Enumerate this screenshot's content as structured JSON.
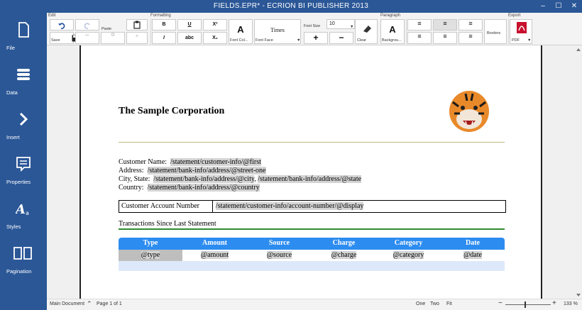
{
  "window": {
    "title": "FIELDS.EPR* - ECRION BI PUBLISHER 2013",
    "minimize": "–",
    "maximize": "☐",
    "close": "✕"
  },
  "nav": [
    {
      "label": "File",
      "icon": "file-icon"
    },
    {
      "label": "Data",
      "icon": "data-icon"
    },
    {
      "label": "Insert",
      "icon": "insert-icon"
    },
    {
      "label": "Properties",
      "icon": "properties-icon"
    },
    {
      "label": "Styles",
      "icon": "styles-icon"
    },
    {
      "label": "Pagination",
      "icon": "pagination-icon"
    }
  ],
  "ribbon": {
    "groups": {
      "edit": "Edit",
      "formatting": "Formatting",
      "paragraph": "Paragraph",
      "export": "Export"
    },
    "save": "Save",
    "paste": "Paste",
    "bold": "B",
    "italic": "I",
    "underline": "U",
    "strike": "abc",
    "superscript": "X²",
    "subscript": "X₂",
    "font_color": "Font Col...",
    "font_color_glyph": "A",
    "font_face": "Font Face",
    "font_face_value": "Times",
    "font_size_label": "Font Size",
    "font_size_value": "10",
    "increase": "+",
    "decrease": "−",
    "clear": "Clear",
    "background": "Backgrou...",
    "background_glyph": "A",
    "borders": "Borders",
    "export_pdf": "PDF"
  },
  "document": {
    "company": "The Sample Corporation",
    "customer": {
      "name_label": "Customer Name:",
      "name_field": "/statement/customer-info/@first",
      "address_label": "Address:",
      "address_field": "/statement/bank-info/address/@street-one",
      "city_label": "City, State:",
      "city_field": "/statement/bank-info/address/@city",
      "state_field": "/statement/bank-info/address/@state",
      "country_label": "Country:",
      "country_field": "/statement/bank-info/address/@country"
    },
    "account_label": "Customer Account Number",
    "account_field": "/statement/customer-info/account-number/@display",
    "transactions_title": "Transactions Since Last Statement",
    "table": {
      "headers": [
        "Type",
        "Amount",
        "Source",
        "Charge",
        "Category",
        "Date"
      ],
      "row": [
        "@type",
        "@amount",
        "@source",
        "@charge",
        "@category",
        "@date"
      ]
    }
  },
  "status": {
    "main_doc": "Main Document",
    "page": "Page 1 of 1",
    "one": "One",
    "two": "Two",
    "fit": "Fit",
    "zoom": "133 %",
    "zoom_fraction": 0.42
  }
}
